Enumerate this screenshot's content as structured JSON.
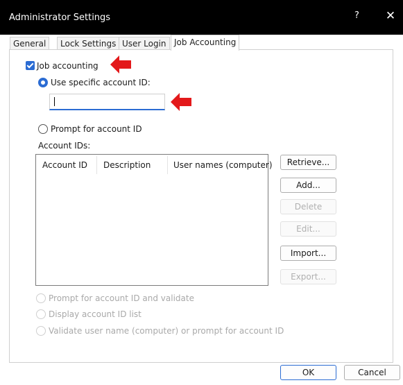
{
  "window": {
    "title": "Administrator Settings",
    "help_label": "?",
    "close_label": "✕"
  },
  "tabs": [
    {
      "label": "General"
    },
    {
      "label": "Lock Settings"
    },
    {
      "label": "User Login"
    },
    {
      "label": "Job Accounting",
      "active": true
    }
  ],
  "job_accounting": {
    "enable_label": "Job accounting",
    "enabled": true,
    "use_specific_label": "Use specific account ID:",
    "account_id_value": "",
    "prompt_label": "Prompt for account ID",
    "list_label": "Account IDs:",
    "columns": [
      "Account ID",
      "Description",
      "User names (computer)"
    ],
    "rows": [],
    "options_disabled": [
      "Prompt for account ID and validate",
      "Display account ID list",
      "Validate user name (computer) or prompt for account ID"
    ]
  },
  "list_buttons": [
    {
      "label": "Retrieve...",
      "enabled": true
    },
    {
      "label": "Add...",
      "enabled": true
    },
    {
      "label": "Delete",
      "enabled": false
    },
    {
      "label": "Edit...",
      "enabled": false
    },
    {
      "label": "Import...",
      "enabled": true
    },
    {
      "label": "Export...",
      "enabled": false
    }
  ],
  "footer": {
    "ok_label": "OK",
    "cancel_label": "Cancel"
  },
  "icons": [
    "check-icon",
    "close-icon",
    "help-icon",
    "red-arrow-annotation-icon"
  ],
  "colors": {
    "accent": "#2b6cd3",
    "annotation": "#e3191b",
    "titlebar": "#000000"
  }
}
